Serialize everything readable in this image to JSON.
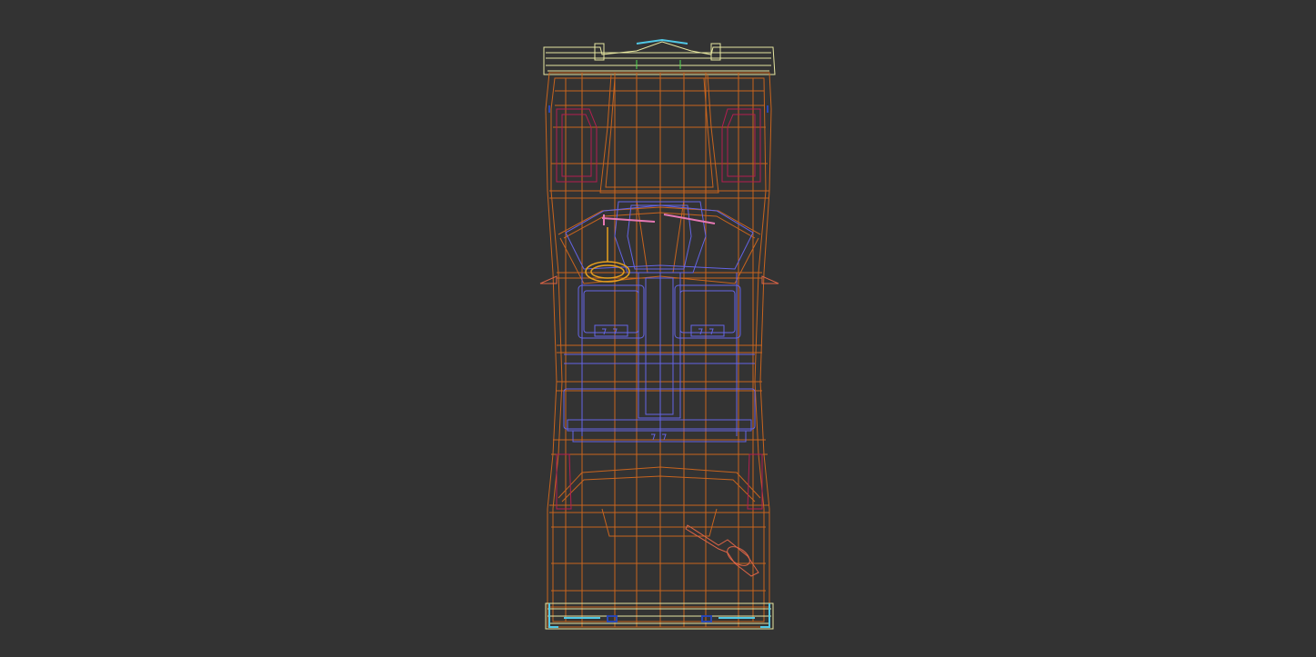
{
  "viewport": {
    "background": "#333333",
    "view": "top",
    "render_mode": "wireframe"
  },
  "model": {
    "subject": "vehicle",
    "colors": {
      "body": "#C8641E",
      "interior": "#6464E6",
      "bumpers": "#E6E6A0",
      "steering_wheel": "#E6A01E",
      "glass_accent": "#50C8E6",
      "panels": "#B41E50",
      "mirrors_accent": "#E678B4",
      "tool": "#DC6446",
      "detail_green": "#50DC50",
      "detail_blue": "#2846B4"
    },
    "icon": "wireframe-car-icon"
  }
}
